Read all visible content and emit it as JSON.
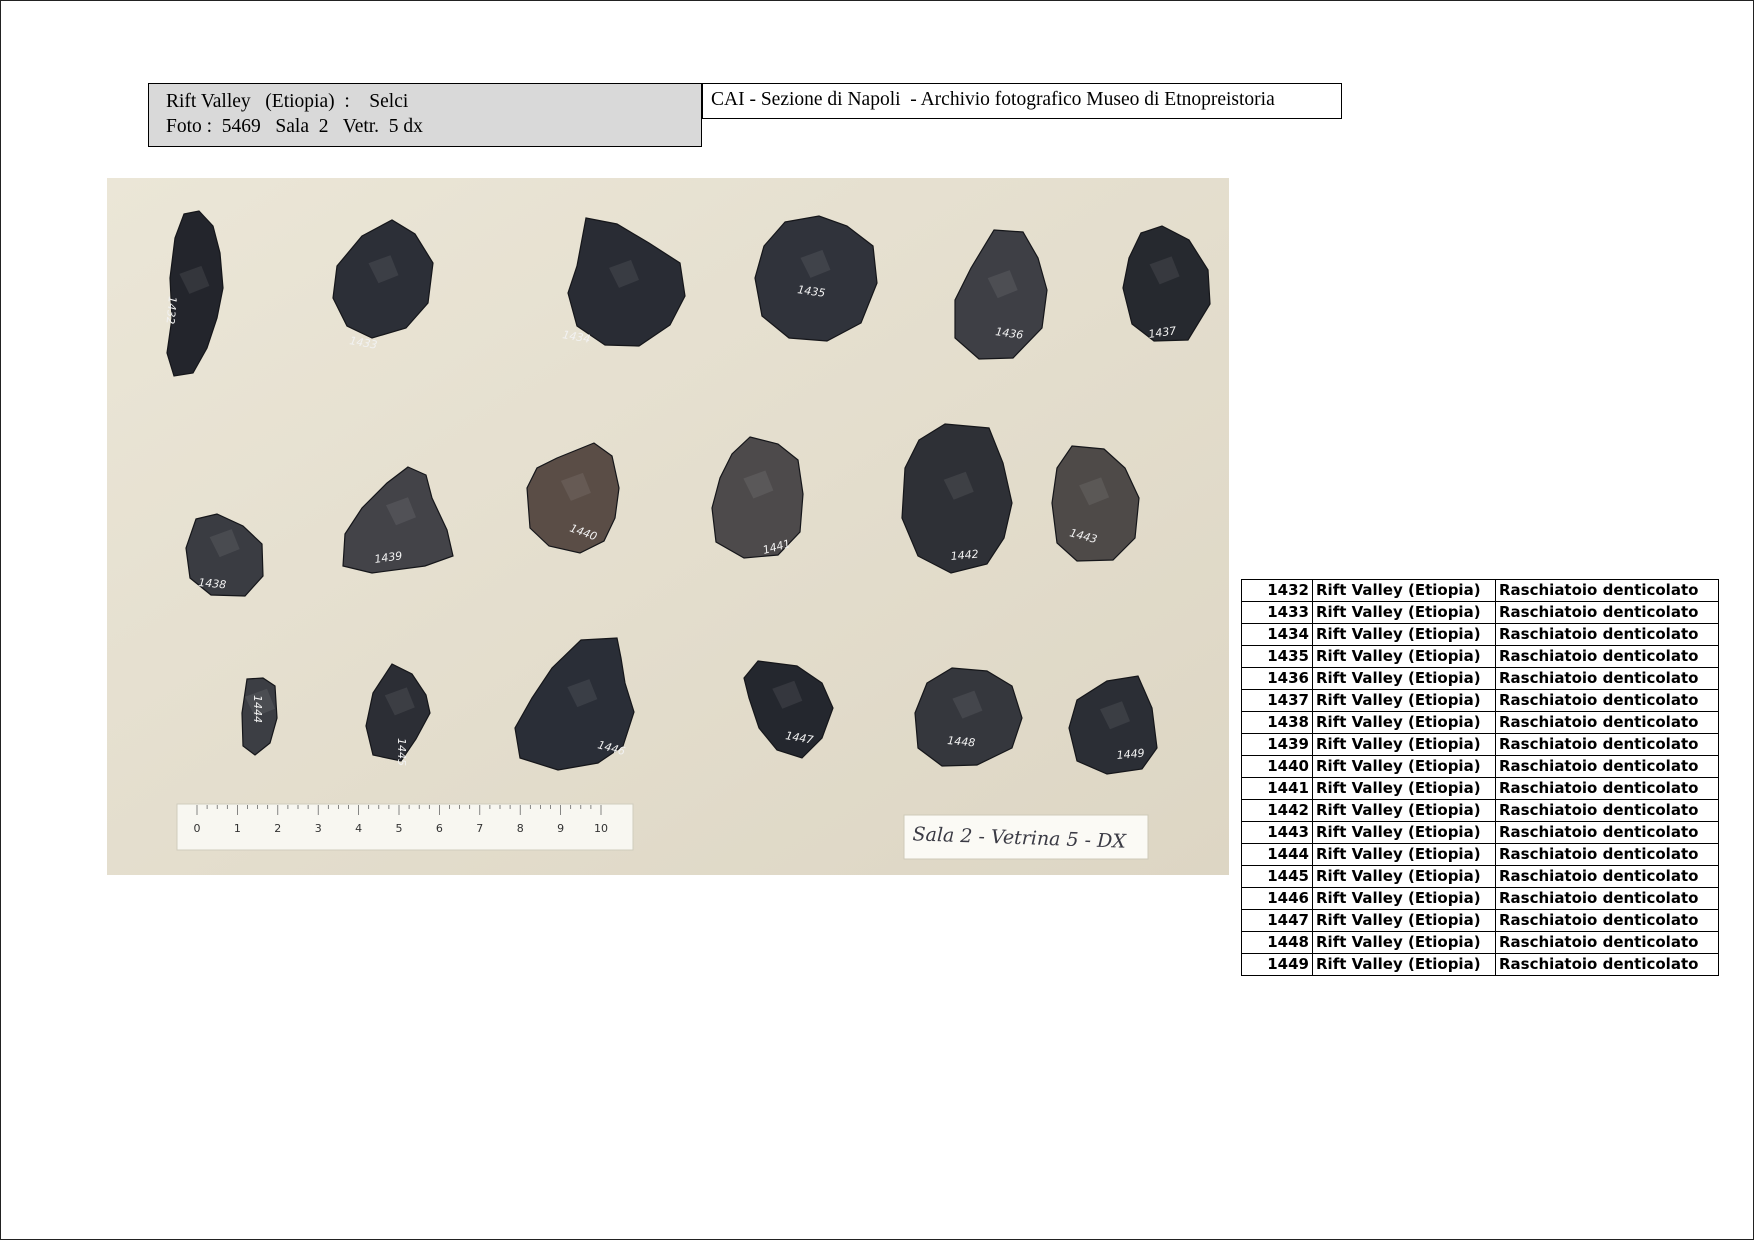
{
  "header": {
    "box_line1": "Rift Valley   (Etiopia)  :    Selci",
    "box_line2": "Foto :  5469   Sala  2   Vetr.  5 dx",
    "archive_title": "CAI - Sezione di Napoli  - Archivio fotografico Museo di Etnopreistoria"
  },
  "photo": {
    "background_color": "#e7e1d1",
    "artifact_labels": [
      "1432",
      "1433",
      "1434",
      "1435",
      "1436",
      "1437",
      "1438",
      "1439",
      "1440",
      "1441",
      "1442",
      "1443",
      "1444",
      "1445",
      "1446",
      "1447",
      "1448",
      "1449"
    ],
    "ruler_ticks": [
      "0",
      "1",
      "2",
      "3",
      "4",
      "5",
      "6",
      "7",
      "8",
      "9",
      "10"
    ],
    "display_card_text": "Sala 2 - Vetrina 5 - DX"
  },
  "catalog": {
    "rows": [
      {
        "num": "1432",
        "location": "Rift Valley (Etiopia)",
        "type": "Raschiatoio denticolato"
      },
      {
        "num": "1433",
        "location": "Rift Valley (Etiopia)",
        "type": "Raschiatoio denticolato"
      },
      {
        "num": "1434",
        "location": "Rift Valley (Etiopia)",
        "type": "Raschiatoio denticolato"
      },
      {
        "num": "1435",
        "location": "Rift Valley (Etiopia)",
        "type": "Raschiatoio denticolato"
      },
      {
        "num": "1436",
        "location": "Rift Valley (Etiopia)",
        "type": "Raschiatoio denticolato"
      },
      {
        "num": "1437",
        "location": "Rift Valley (Etiopia)",
        "type": "Raschiatoio denticolato"
      },
      {
        "num": "1438",
        "location": "Rift Valley (Etiopia)",
        "type": "Raschiatoio denticolato"
      },
      {
        "num": "1439",
        "location": "Rift Valley (Etiopia)",
        "type": "Raschiatoio denticolato"
      },
      {
        "num": "1440",
        "location": "Rift Valley (Etiopia)",
        "type": "Raschiatoio denticolato"
      },
      {
        "num": "1441",
        "location": "Rift Valley (Etiopia)",
        "type": "Raschiatoio denticolato"
      },
      {
        "num": "1442",
        "location": "Rift Valley (Etiopia)",
        "type": "Raschiatoio denticolato"
      },
      {
        "num": "1443",
        "location": "Rift Valley (Etiopia)",
        "type": "Raschiatoio denticolato"
      },
      {
        "num": "1444",
        "location": "Rift Valley (Etiopia)",
        "type": "Raschiatoio denticolato"
      },
      {
        "num": "1445",
        "location": "Rift Valley (Etiopia)",
        "type": "Raschiatoio denticolato"
      },
      {
        "num": "1446",
        "location": "Rift Valley (Etiopia)",
        "type": "Raschiatoio denticolato"
      },
      {
        "num": "1447",
        "location": "Rift Valley (Etiopia)",
        "type": "Raschiatoio denticolato"
      },
      {
        "num": "1448",
        "location": "Rift Valley (Etiopia)",
        "type": "Raschiatoio denticolato"
      },
      {
        "num": "1449",
        "location": "Rift Valley (Etiopia)",
        "type": "Raschiatoio denticolato"
      }
    ]
  }
}
